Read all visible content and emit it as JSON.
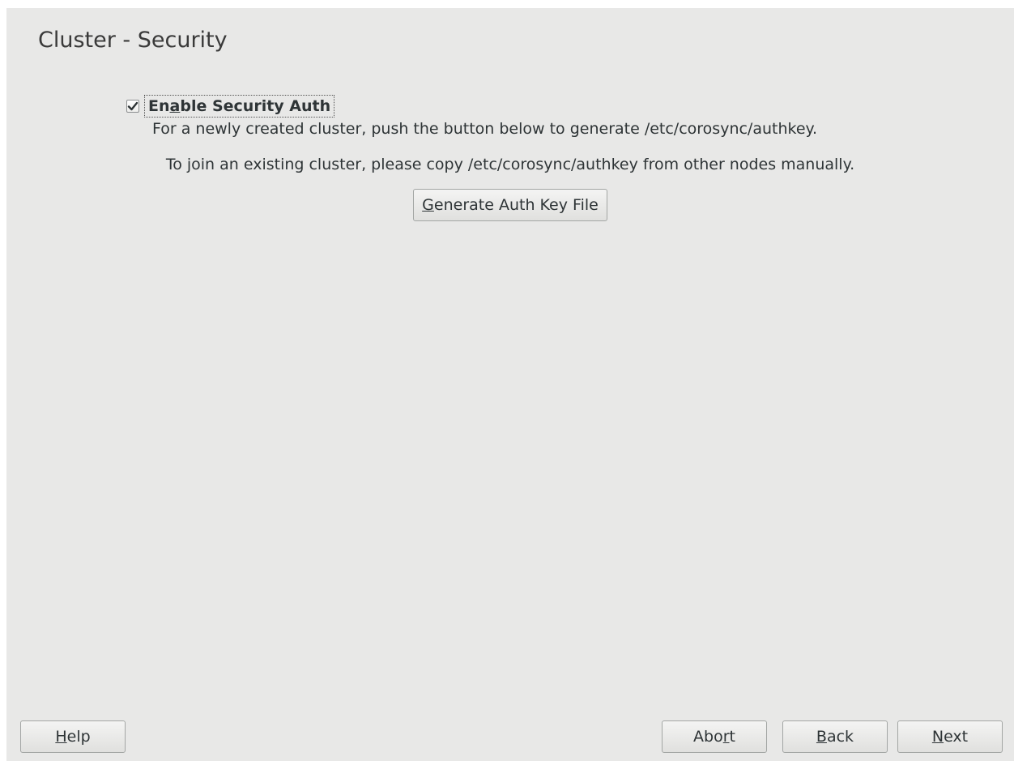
{
  "page": {
    "title": "Cluster - Security"
  },
  "security": {
    "checkbox_label_pre": "En",
    "checkbox_label_mnemonic": "a",
    "checkbox_label_post": "ble Security Auth",
    "checkbox_checked": true,
    "description_1": "For a newly created cluster, push the button below to generate /etc/corosync/authkey.",
    "description_2": "To join an existing cluster, please copy /etc/corosync/authkey from other nodes manually.",
    "generate_button": {
      "mnemonic": "G",
      "rest": "enerate Auth Key File"
    }
  },
  "footer": {
    "help": {
      "mnemonic": "H",
      "rest": "elp"
    },
    "abort": {
      "pre": "Abo",
      "mnemonic": "r",
      "post": "t"
    },
    "back": {
      "mnemonic": "B",
      "rest": "ack"
    },
    "next": {
      "mnemonic": "N",
      "rest": "ext"
    }
  },
  "icons": {
    "checkmark": "checkmark-icon"
  }
}
